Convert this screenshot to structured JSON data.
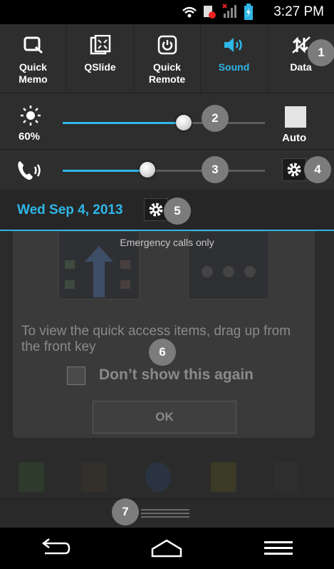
{
  "status_bar": {
    "time": "3:27 PM"
  },
  "quick_settings": [
    {
      "label": "Quick\nMemo",
      "icon": "quick-memo-icon",
      "active": false
    },
    {
      "label": "QSlide",
      "icon": "qslide-icon",
      "active": false
    },
    {
      "label": "Quick\nRemote",
      "icon": "quick-remote-icon",
      "active": false
    },
    {
      "label": "Sound",
      "icon": "sound-icon",
      "active": true
    },
    {
      "label": "Data",
      "icon": "data-icon",
      "active": false
    }
  ],
  "brightness": {
    "percent_label": "60%",
    "level": 0.6,
    "auto_label": "Auto"
  },
  "volume": {
    "level": 0.42
  },
  "date": {
    "text": "Wed Sep 4, 2013"
  },
  "emergency": {
    "text": "Emergency calls only"
  },
  "dialog": {
    "message": "To view the quick access items, drag up from the front key",
    "checkbox_label": "Don’t show this again",
    "ok_label": "OK"
  },
  "callouts": [
    "1",
    "2",
    "3",
    "4",
    "5",
    "6",
    "7"
  ],
  "colors": {
    "accent": "#2fb6e6",
    "badge": "#7c7c7c"
  }
}
